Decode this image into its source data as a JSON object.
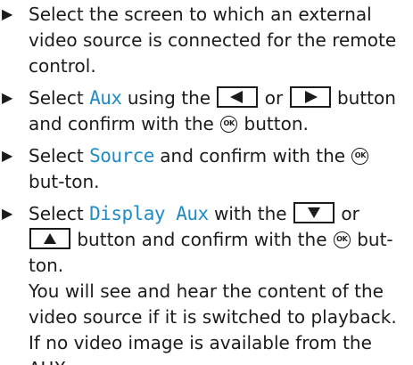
{
  "steps": [
    {
      "text": "Select the screen to which an external video source is connected for the remote control."
    },
    {
      "pre": "Select ",
      "highlight": "Aux",
      "mid1": " using the ",
      "mid2": " or ",
      "mid3": " button and confirm with the ",
      "post": " button."
    },
    {
      "pre": "Select ",
      "highlight": "Source",
      "mid": " and confirm with the ",
      "post": " but-ton."
    },
    {
      "pre": "Select ",
      "highlight": "Display Aux",
      "mid1": " with the ",
      "mid2": " or ",
      "mid3": " button and confirm with the ",
      "post": " but-ton."
    }
  ],
  "note": "You will see and hear the content of the video source if it is switched to playback. If no video image is available from the AUX",
  "ok_label": "OK",
  "icons": {
    "bullet": "triangle-right",
    "left": "left-arrow-button",
    "right": "right-arrow-button",
    "down": "down-arrow-button",
    "up": "up-arrow-button",
    "ok": "ok-button-symbol"
  },
  "colors": {
    "highlight": "#1f8bc6",
    "text": "#1b1b1b"
  }
}
